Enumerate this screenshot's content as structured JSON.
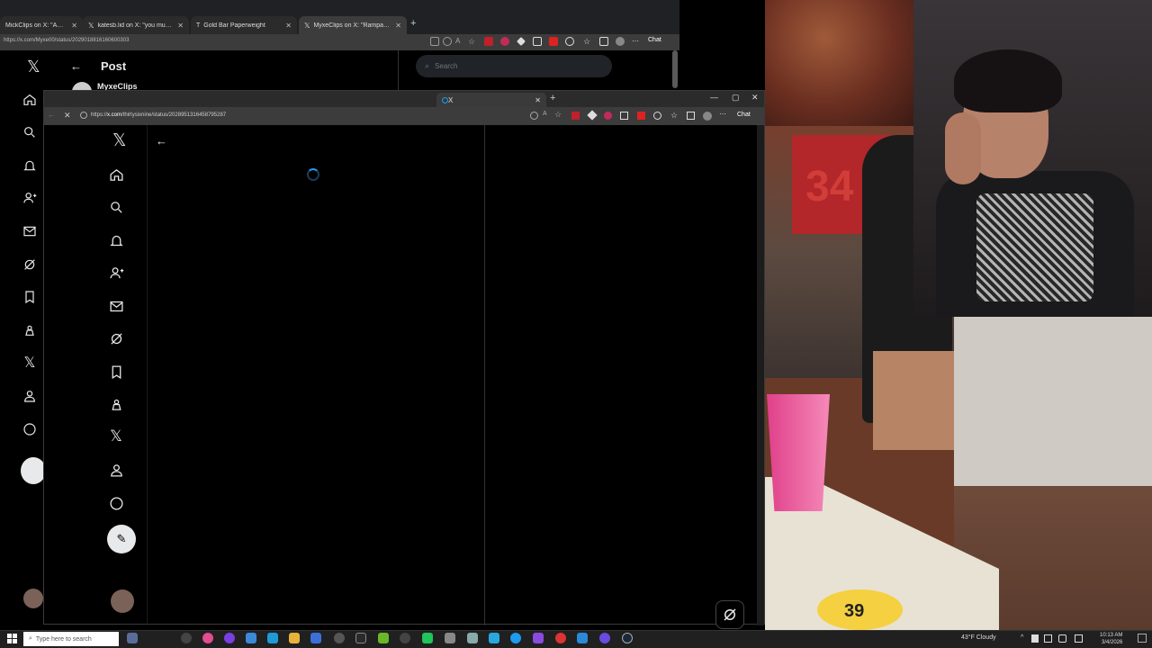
{
  "back_browser": {
    "tabs": [
      {
        "label": "MickClips on X: \"Amouranth is"
      },
      {
        "label": "katesb.lid on X: \"you must to go a"
      },
      {
        "label": "Gold Bar Paperweight"
      },
      {
        "label": "MyxeClips on X: \"Rampage Jackson"
      }
    ],
    "url": "https://x.com/Myxe00/status/2029018816160600303",
    "chat_label": "Chat",
    "page_title": "Post",
    "search_placeholder": "Search",
    "account_name": "MyxeClips"
  },
  "front_browser": {
    "tab_label": "X",
    "url_prefix": "https://",
    "url_host": "x.com",
    "url_path": "/thirtysixnine/status/2028951316458795287",
    "chat_label": "Chat"
  },
  "nav_icons": [
    "x-logo-icon",
    "home-icon",
    "search-icon",
    "bell-icon",
    "add-user-icon",
    "mail-icon",
    "grok-icon",
    "bookmark-icon",
    "premium-icon",
    "x-icon",
    "profile-icon",
    "more-icon",
    "post-icon",
    "avatar"
  ],
  "stream": {
    "irl_sign_text": "34",
    "badge_text": "39"
  },
  "taskbar": {
    "search_placeholder": "Type here to search",
    "weather": "43°F  Cloudy",
    "time": "10:13 AM",
    "date": "3/4/2026"
  },
  "colors": {
    "accent": "#1d9bf0",
    "background": "#000000",
    "taskbar": "#202020"
  }
}
